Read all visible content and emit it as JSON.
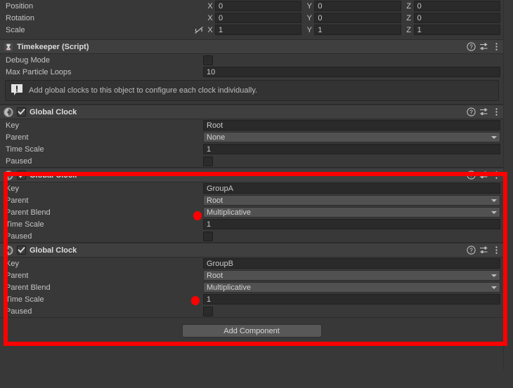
{
  "transform": {
    "rows": [
      {
        "label": "Position",
        "showLink": false,
        "axes": [
          {
            "axis": "X",
            "value": "0"
          },
          {
            "axis": "Y",
            "value": "0"
          },
          {
            "axis": "Z",
            "value": "0"
          }
        ]
      },
      {
        "label": "Rotation",
        "showLink": false,
        "axes": [
          {
            "axis": "X",
            "value": "0"
          },
          {
            "axis": "Y",
            "value": "0"
          },
          {
            "axis": "Z",
            "value": "0"
          }
        ]
      },
      {
        "label": "Scale",
        "showLink": true,
        "link_icon": "constrained-proportions-off-icon",
        "axes": [
          {
            "axis": "X",
            "value": "1"
          },
          {
            "axis": "Y",
            "value": "1"
          },
          {
            "axis": "Z",
            "value": "1"
          }
        ]
      }
    ]
  },
  "timekeeper": {
    "icon": "hourglass-script-icon",
    "title": "Timekeeper (Script)",
    "help_icon": "help-icon",
    "preset_icon": "preset-icon",
    "menu_icon": "kebab-menu-icon",
    "fields": {
      "debug_mode_label": "Debug Mode",
      "debug_mode_checked": false,
      "max_particle_loops_label": "Max Particle Loops",
      "max_particle_loops_value": "10"
    },
    "helpbox": {
      "icon": "info-exclamation-icon",
      "text": "Add global clocks to this object to configure each clock individually."
    }
  },
  "clocks": [
    {
      "icon": "script-ball-icon",
      "enabled": true,
      "title": "Global Clock",
      "help_icon": "help-icon",
      "preset_icon": "preset-icon",
      "menu_icon": "kebab-menu-icon",
      "rows": [
        {
          "type": "text",
          "label": "Key",
          "value": "Root"
        },
        {
          "type": "dropdown",
          "label": "Parent",
          "value": "None"
        },
        {
          "type": "text",
          "label": "Time Scale",
          "value": "1"
        },
        {
          "type": "checkbox",
          "label": "Paused",
          "checked": false
        }
      ]
    },
    {
      "icon": "script-ball-icon",
      "enabled": true,
      "title": "Global Clock",
      "help_icon": "help-icon",
      "preset_icon": "preset-icon",
      "menu_icon": "kebab-menu-icon",
      "rows": [
        {
          "type": "text",
          "label": "Key",
          "value": "GroupA"
        },
        {
          "type": "dropdown",
          "label": "Parent",
          "value": "Root",
          "marked": true
        },
        {
          "type": "dropdown",
          "label": "Parent Blend",
          "value": "Multiplicative"
        },
        {
          "type": "text",
          "label": "Time Scale",
          "value": "1"
        },
        {
          "type": "checkbox",
          "label": "Paused",
          "checked": false
        }
      ]
    },
    {
      "icon": "script-ball-icon",
      "enabled": true,
      "title": "Global Clock",
      "help_icon": "help-icon",
      "preset_icon": "preset-icon",
      "menu_icon": "kebab-menu-icon",
      "rows": [
        {
          "type": "text",
          "label": "Key",
          "value": "GroupB"
        },
        {
          "type": "dropdown",
          "label": "Parent",
          "value": "Root",
          "marked": true
        },
        {
          "type": "dropdown",
          "label": "Parent Blend",
          "value": "Multiplicative"
        },
        {
          "type": "text",
          "label": "Time Scale",
          "value": "1"
        },
        {
          "type": "checkbox",
          "label": "Paused",
          "checked": false
        }
      ]
    }
  ],
  "add_component": {
    "label": "Add Component"
  },
  "annotation": {
    "border_color": "#ff0000",
    "dot_color": "#ff0000",
    "dot_count": 2
  }
}
